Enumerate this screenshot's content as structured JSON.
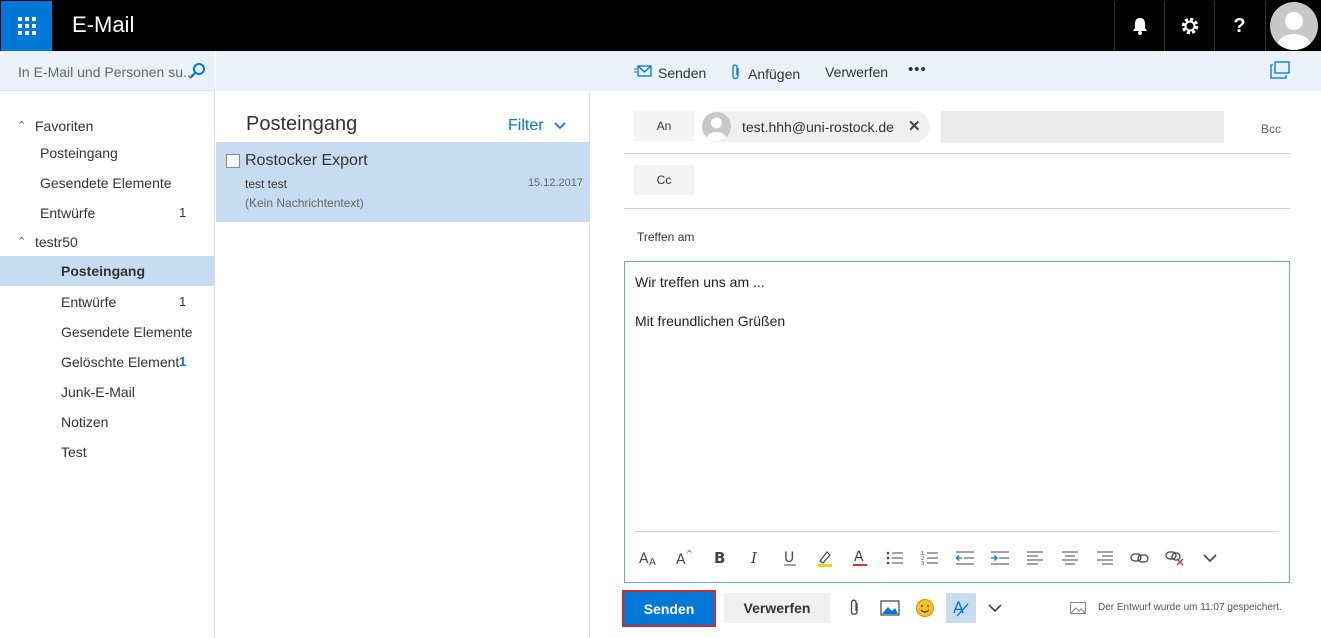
{
  "topbar": {
    "title": "E-Mail",
    "icons": [
      "waffle-icon",
      "bell-icon",
      "gear-icon",
      "help-icon",
      "avatar-icon"
    ],
    "help_label": "?"
  },
  "search": {
    "placeholder": "In E-Mail und Personen su..."
  },
  "commands": {
    "send": "Senden",
    "attach": "Anfügen",
    "discard": "Verwerfen",
    "more": "•••"
  },
  "nav": {
    "groups": [
      {
        "label": "Favoriten",
        "items": [
          {
            "label": "Posteingang",
            "count": ""
          },
          {
            "label": "Gesendete Elemente",
            "count": ""
          },
          {
            "label": "Entwürfe",
            "count": "1"
          }
        ]
      },
      {
        "label": "testr50",
        "items": [
          {
            "label": "Posteingang",
            "count": "",
            "selected": true
          },
          {
            "label": "Entwürfe",
            "count": "1"
          },
          {
            "label": "Gesendete Elemente",
            "count": ""
          },
          {
            "label": "Gelöschte Element",
            "count": "1"
          },
          {
            "label": "Junk-E-Mail",
            "count": ""
          },
          {
            "label": "Notizen",
            "count": ""
          },
          {
            "label": "Test",
            "count": ""
          }
        ]
      }
    ]
  },
  "message_list": {
    "title": "Posteingang",
    "filter": "Filter",
    "messages": [
      {
        "subject": "Rostocker Export",
        "from": "test test",
        "date": "15.12.2017",
        "preview": "(Kein Nachrichtentext)"
      }
    ]
  },
  "compose": {
    "to_label": "An",
    "cc_label": "Cc",
    "bcc_label": "Bcc",
    "recipient": "test.hhh@uni-rostock.de",
    "remove_glyph": "✕",
    "subject": "Treffen am",
    "body_lines": [
      "Wir treffen uns am ...",
      "Mit freundlichen Grüßen"
    ],
    "send_label": "Senden",
    "discard_label": "Verwerfen",
    "saved_status": "Der Entwurf wurde um 11:07 gespeichert."
  },
  "formatting_icons": [
    "font-size-icon",
    "grow-font-icon",
    "bold-icon",
    "italic-icon",
    "underline-icon",
    "highlight-icon",
    "font-color-icon",
    "bullets-icon",
    "numbering-icon",
    "decrease-indent-icon",
    "increase-indent-icon",
    "align-left-icon",
    "align-center-icon",
    "align-right-icon",
    "insert-link-icon",
    "remove-link-icon",
    "more-formatting-icon"
  ],
  "colors": {
    "accent": "#0078d7",
    "selected": "#c7dcf0",
    "commandbar": "#eaf1f8",
    "send_outline": "#d0282e"
  }
}
